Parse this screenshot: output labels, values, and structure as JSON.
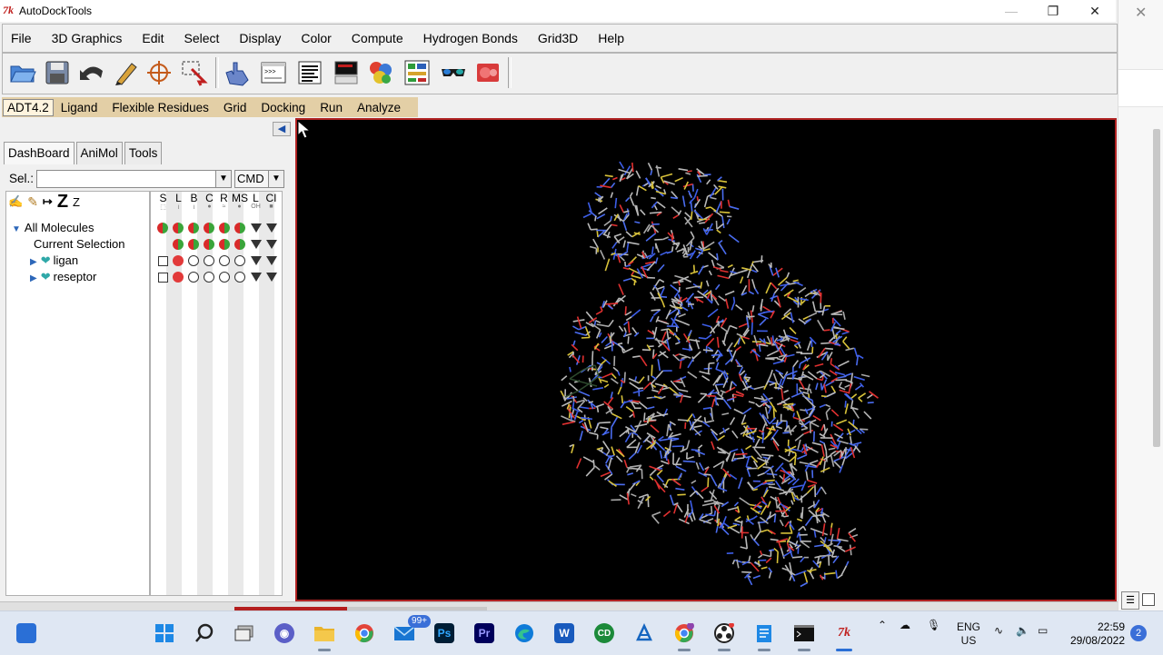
{
  "window": {
    "app_icon": "7k",
    "title": "AutoDockTools",
    "minimize_icon": "minimize-icon",
    "maximize_icon": "restore-icon",
    "close_icon": "close-icon"
  },
  "menubar": {
    "items": [
      "File",
      "3D Graphics",
      "Edit",
      "Select",
      "Display",
      "Color",
      "Compute",
      "Hydrogen Bonds",
      "Grid3D",
      "Help"
    ]
  },
  "toolbar": {
    "icons": [
      "open-folder-icon",
      "save-icon",
      "undo-icon",
      "pencil-icon",
      "crosshair-icon",
      "select-icon",
      "hand-icon",
      "python-shell-icon",
      "text-lines-icon",
      "monitor-icon",
      "color-molecule-icon",
      "dashboard-icon",
      "stereo-glasses-icon",
      "movie-icon"
    ]
  },
  "adt_bar": {
    "items": [
      "ADT4.2",
      "Ligand",
      "Flexible Residues",
      "Grid",
      "Docking",
      "Run",
      "Analyze"
    ]
  },
  "left_panel": {
    "tabs": [
      "DashBoard",
      "AniMol",
      "Tools"
    ],
    "sel_label": "Sel.:",
    "sel_value": "",
    "cmd_value": "CMD",
    "tree_tool_icons": [
      "select-tool-icon",
      "pencil-tool-icon",
      "width-tool-icon",
      "z-large-icon",
      "z-small-icon"
    ],
    "tree": [
      {
        "label": "All Molecules",
        "expanded": true
      },
      {
        "label": "Current Selection"
      },
      {
        "label": "ligan"
      },
      {
        "label": "reseptor"
      }
    ],
    "columns": [
      "S",
      "L",
      "B",
      "C",
      "R",
      "MS",
      "L",
      "CI"
    ]
  },
  "taskbar": {
    "mail_badge": "99+",
    "photoshop_label": "Ps",
    "premiere_label": "Pr",
    "word_label": "W",
    "lang": "ENG",
    "region": "US",
    "time": "22:59",
    "date": "29/08/2022",
    "notification_count": "2"
  },
  "colors": {
    "accent_red": "#b02222",
    "adt_bar": "#e3cfa6",
    "viewer_bg": "#000000"
  }
}
